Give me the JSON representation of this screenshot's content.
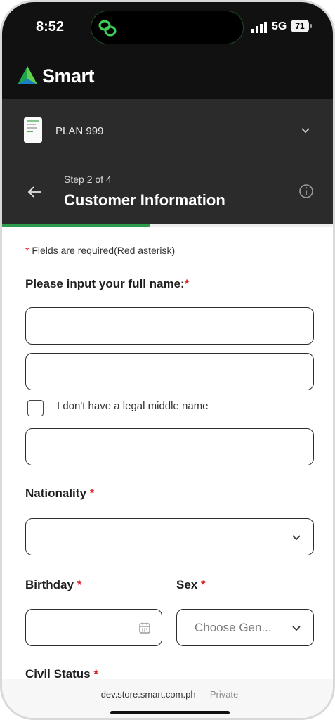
{
  "status_bar": {
    "time": "8:52",
    "network": "5G",
    "battery": "71"
  },
  "brand": {
    "name": "Smart",
    "color": "#2e9c4a"
  },
  "plan": {
    "name": "PLAN 999"
  },
  "step": {
    "label": "Step 2 of 4",
    "title": "Customer Information",
    "progress": 0.44
  },
  "form": {
    "required_note": {
      "asterisk": "*",
      "text": " Fields are required(Red asterisk)"
    },
    "full_name": {
      "label": "Please input your full name:",
      "asterisk": "*",
      "first_name_value": "",
      "middle_name_value": "",
      "last_name_value": ""
    },
    "no_middle_name": {
      "label": "I don't have a legal middle name",
      "checked": false
    },
    "nationality": {
      "label": "Nationality",
      "asterisk": "*",
      "value": ""
    },
    "birthday": {
      "label": "Birthday",
      "asterisk": "*",
      "value": ""
    },
    "sex": {
      "label": "Sex",
      "asterisk": "*",
      "placeholder": "Choose Gen..."
    },
    "civil_status": {
      "label": "Civil Status",
      "asterisk": "*"
    }
  },
  "browser": {
    "url": "dev.store.smart.com.ph",
    "separator": " — ",
    "mode": "Private"
  },
  "icons": {
    "status": [
      "chain-link-icon",
      "signal-icon"
    ],
    "header": [
      "smart-logo-icon",
      "plan-thumbnail-icon",
      "chevron-down-icon",
      "back-arrow-icon",
      "info-icon"
    ],
    "form": [
      "calendar-icon",
      "chevron-down-icon"
    ]
  }
}
